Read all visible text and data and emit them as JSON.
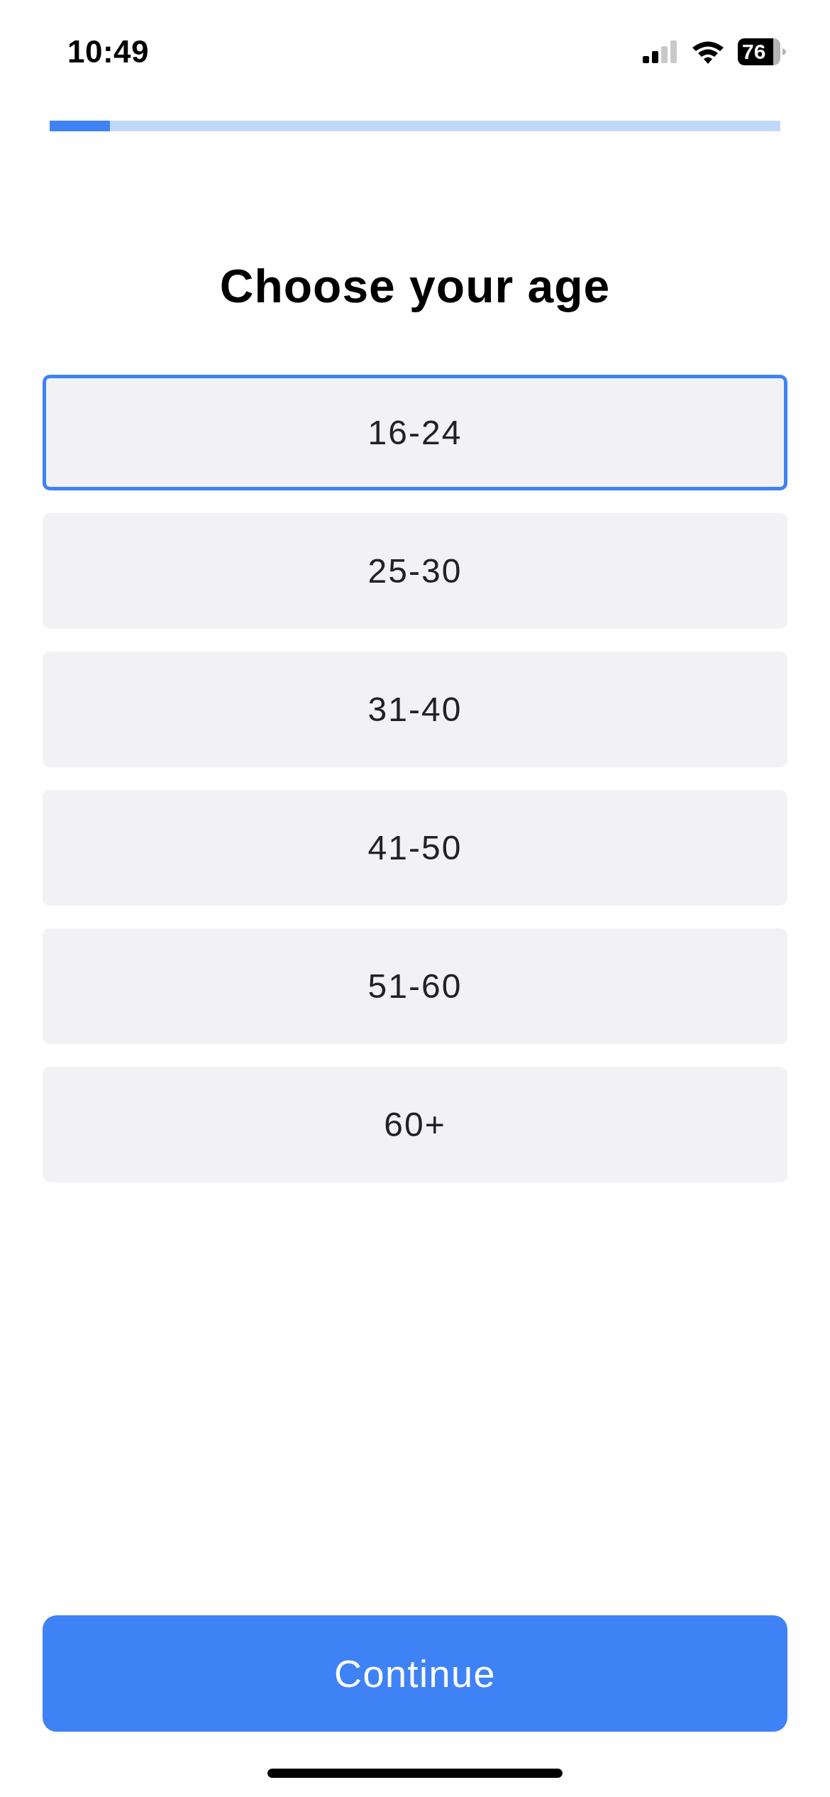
{
  "status_bar": {
    "time": "10:49",
    "battery": "76"
  },
  "progress": {
    "level": 0.083
  },
  "title": "Choose your age",
  "options": [
    {
      "label": "16-24",
      "selected": true
    },
    {
      "label": "25-30",
      "selected": false
    },
    {
      "label": "31-40",
      "selected": false
    },
    {
      "label": "41-50",
      "selected": false
    },
    {
      "label": "51-60",
      "selected": false
    },
    {
      "label": "60+",
      "selected": false
    }
  ],
  "continue_button": {
    "label": "Continue"
  }
}
